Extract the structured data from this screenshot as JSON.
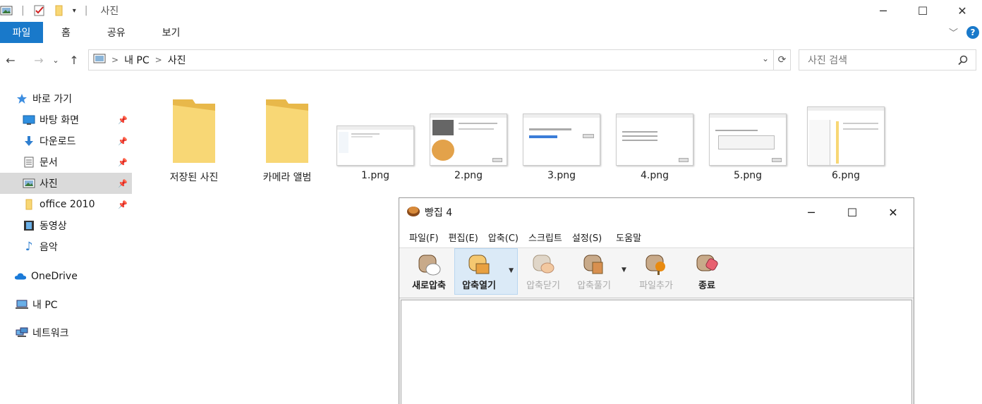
{
  "window": {
    "title": "사진",
    "separator": "|"
  },
  "ribbon": {
    "tabs": [
      "파일",
      "홈",
      "공유",
      "보기"
    ],
    "help": "?"
  },
  "address": {
    "crumbs": [
      "내 PC",
      "사진"
    ],
    "search_placeholder": "사진 검색"
  },
  "sidebar": {
    "quick_access": "바로 가기",
    "items": [
      {
        "label": "바탕 화면"
      },
      {
        "label": "다운로드"
      },
      {
        "label": "문서"
      },
      {
        "label": "사진"
      },
      {
        "label": "office 2010"
      },
      {
        "label": "동영상"
      },
      {
        "label": "음악"
      }
    ],
    "onedrive": "OneDrive",
    "this_pc": "내 PC",
    "network": "네트워크"
  },
  "files": [
    {
      "label": "저장된 사진",
      "kind": "folder"
    },
    {
      "label": "카메라 앨범",
      "kind": "folder"
    },
    {
      "label": "1.png",
      "kind": "image"
    },
    {
      "label": "2.png",
      "kind": "image"
    },
    {
      "label": "3.png",
      "kind": "image"
    },
    {
      "label": "4.png",
      "kind": "image"
    },
    {
      "label": "5.png",
      "kind": "image"
    },
    {
      "label": "6.png",
      "kind": "image"
    }
  ],
  "bandizip": {
    "title": "빵집 4",
    "menu": [
      "파일(F)",
      "편집(E)",
      "압축(C)",
      "스크립트",
      "설정(S)",
      "도움말"
    ],
    "toolbar": [
      "새로압축",
      "압축열기",
      "압축닫기",
      "압축풀기",
      "파일추가",
      "종료"
    ]
  },
  "colors": {
    "accent": "#1979ca",
    "folder": "#f8d775",
    "folder_dark": "#e8b84a",
    "selected": "#dadada"
  }
}
